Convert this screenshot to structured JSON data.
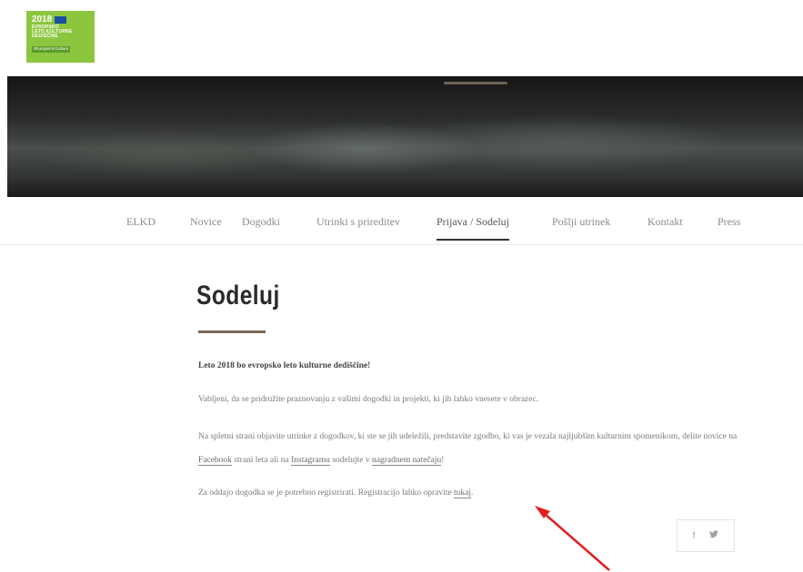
{
  "logo": {
    "year": "2018",
    "line1": "EVROPSKO",
    "line2": "LETO KULTURNE",
    "line3": "DEDIŠČINE",
    "tag": "#EuropeForCulture",
    "colors": {
      "background": "#8cc63f",
      "flag": "#1d4fa0"
    }
  },
  "nav": {
    "items": [
      {
        "label": "ELKD"
      },
      {
        "label": "Novice"
      },
      {
        "label": "Dogodki"
      },
      {
        "label": "Utrinki s prireditev"
      },
      {
        "label": "Prijava / Sodeluj",
        "active": true
      },
      {
        "label": "Pošlji utrinek"
      },
      {
        "label": "Kontakt"
      },
      {
        "label": "Press"
      }
    ]
  },
  "page": {
    "title": "Sodeluj",
    "lead": "Leto 2018 bo evropsko leto kulturne dediščine!",
    "p1": "Vabljeni, da se pridružite praznovanju z vašimi dogodki in projekti, ki jih lahko vnesete v obrazec.",
    "p2_part1": "Na spletni strani objavite utrinke z dogodkov, ki ste se jih udeležili, predstavite zgodbo, ki vas je vezala najljubšim kulturnim spomenikom, delite novice na",
    "p2_link_facebook": "Facebook",
    "p2_part2": "strani leta ali na",
    "p2_link_instagram": "Instagramu",
    "p2_part3": "sodelujte v",
    "p2_link_contest": "nagradnem natečaju",
    "p2_end": "!",
    "p3_part1": "Za oddajo dogodka se je potrebno registrirati. Registracijo lahko opravite",
    "p3_link": "tukaj",
    "p3_end": "."
  },
  "share": {
    "facebook_icon": "f",
    "twitter_icon": "t"
  },
  "annotation": {
    "arrow_color": "#e02020"
  }
}
